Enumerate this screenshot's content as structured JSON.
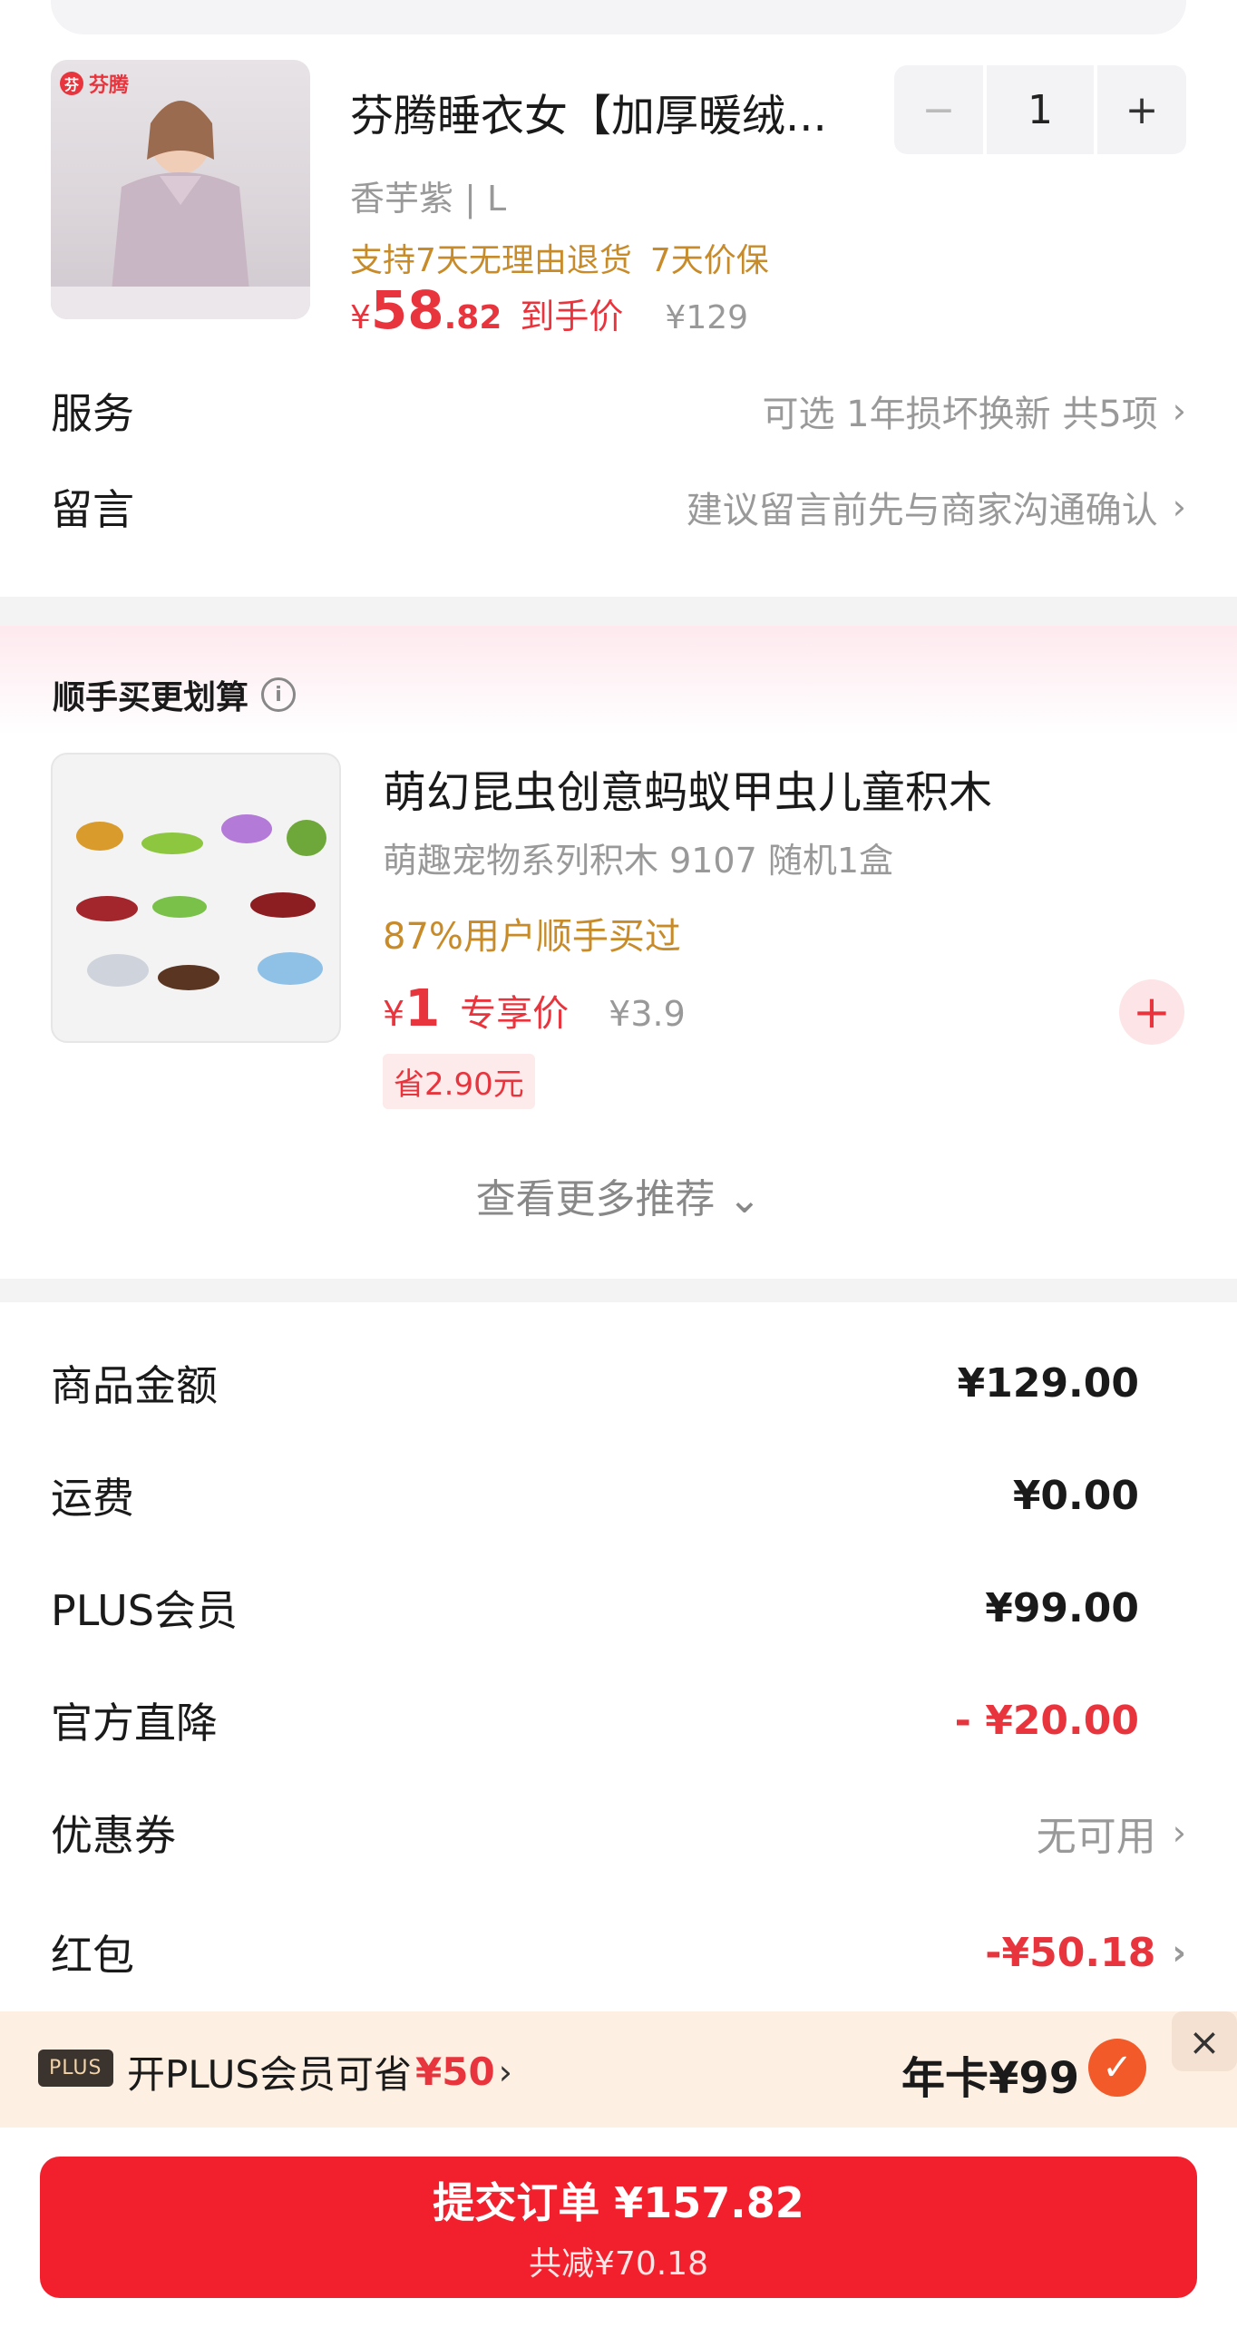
{
  "product": {
    "brand": "芬腾",
    "title": "芬腾睡衣女【加厚暖绒...",
    "qty_minus": "−",
    "qty": "1",
    "qty_plus": "+",
    "spec": "香芋紫 | L",
    "perk_return": "支持7天无理由退货",
    "perk_price": "7天价保",
    "price_currency": "¥",
    "price_int": "58",
    "price_dec": ".82",
    "price_tag": "到手价",
    "orig_price": "¥129"
  },
  "service": {
    "label": "服务",
    "value": "可选 1年损坏换新 共5项"
  },
  "message": {
    "label": "留言",
    "value": "建议留言前先与商家沟通确认"
  },
  "recommend": {
    "title": "顺手买更划算",
    "item": {
      "title": "萌幻昆虫创意蚂蚁甲虫儿童积木",
      "subtitle": "萌趣宠物系列积木 9107 随机1盒",
      "bought": "87%用户顺手买过",
      "currency": "¥",
      "price": "1",
      "price_tag": "专享价",
      "orig_price": "¥3.9",
      "save": "省2.90元"
    },
    "see_more": "查看更多推荐 ⌄"
  },
  "summary": {
    "goods": {
      "label": "商品金额",
      "value": "¥129.00"
    },
    "shipping": {
      "label": "运费",
      "value": "¥0.00"
    },
    "plus": {
      "label": "PLUS会员",
      "value": "¥99.00"
    },
    "discount": {
      "label": "官方直降",
      "value": "- ¥20.00"
    },
    "coupon": {
      "label": "优惠券",
      "value": "无可用"
    },
    "redpacket": {
      "label": "红包",
      "value": "-¥50.18"
    }
  },
  "plus_banner": {
    "badge": "PLUS",
    "text_pre": "开PLUS会员可省",
    "text_amount": "¥50",
    "year_card": "年卡¥99",
    "close": "×"
  },
  "submit": {
    "main": "提交订单 ¥157.82",
    "sub": "共减¥70.18"
  },
  "colors": {
    "accent_red": "#e8343d",
    "gold": "#c88b2a",
    "button_red": "#f2202d"
  }
}
